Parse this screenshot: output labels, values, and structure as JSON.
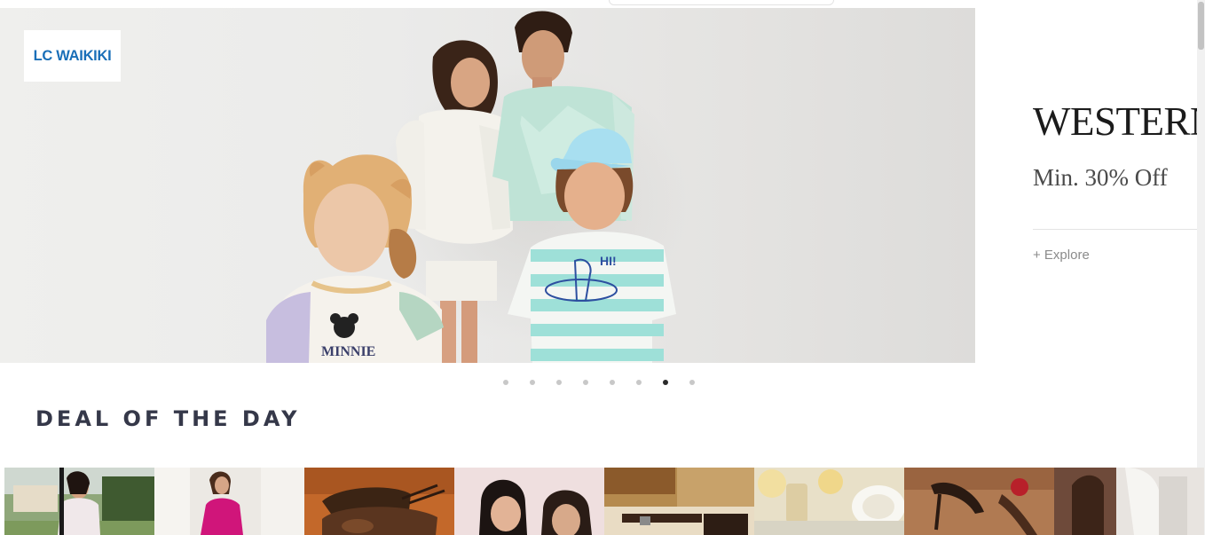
{
  "hero": {
    "brand_logo": "LC WAIKIKI",
    "side_title": "WESTERN",
    "side_subtitle": "Min. 30% Off",
    "explore_label": "+ Explore"
  },
  "carousel": {
    "dot_count": 8,
    "active_index": 6
  },
  "deals": {
    "heading": "DEAL OF THE DAY",
    "tiles": [
      {
        "scene": "woman-in-park"
      },
      {
        "scene": "woman-pink-dress"
      },
      {
        "scene": "brown-leather-shoes"
      },
      {
        "scene": "two-women-portrait"
      },
      {
        "scene": "leather-belt-wallet"
      },
      {
        "scene": "glassware-tableware"
      },
      {
        "scene": "heeled-sandals"
      },
      {
        "scene": "loafers"
      }
    ]
  },
  "colors": {
    "accent_heading": "#353849",
    "logo_blue": "#1a6fb8"
  }
}
